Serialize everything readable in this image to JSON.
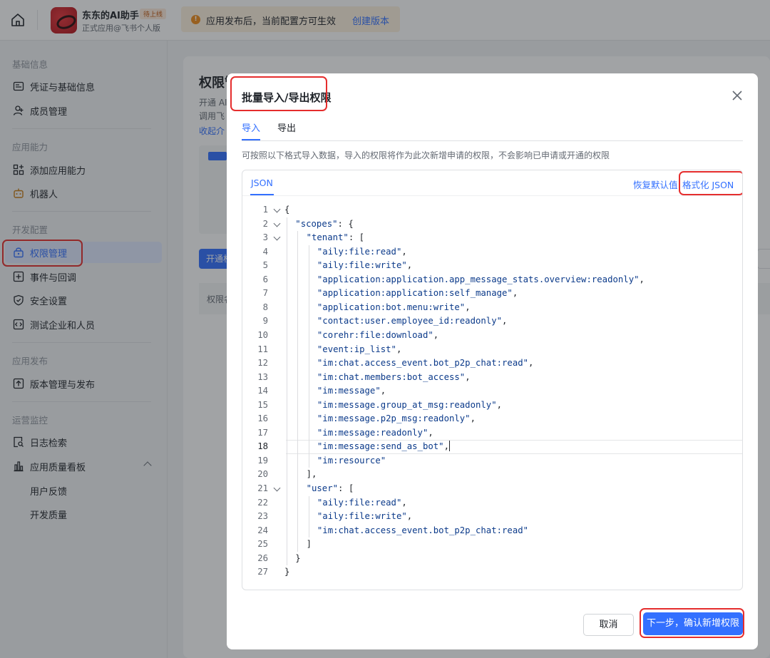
{
  "topbar": {
    "app_name": "东东的AI助手",
    "app_badge": "待上线",
    "app_sub": "正式应用@飞书个人版",
    "notice_text": "应用发布后，当前配置方可生效",
    "notice_link": "创建版本"
  },
  "sidebar": {
    "sections": [
      {
        "title": "基础信息",
        "items": [
          {
            "label": "凭证与基础信息",
            "icon": "credential-icon"
          },
          {
            "label": "成员管理",
            "icon": "member-icon"
          }
        ]
      },
      {
        "title": "应用能力",
        "items": [
          {
            "label": "添加应用能力",
            "icon": "grid-add-icon"
          },
          {
            "label": "机器人",
            "icon": "robot-icon"
          }
        ]
      },
      {
        "title": "开发配置",
        "items": [
          {
            "label": "权限管理",
            "icon": "lock-icon"
          },
          {
            "label": "事件与回调",
            "icon": "event-icon"
          },
          {
            "label": "安全设置",
            "icon": "shield-icon"
          },
          {
            "label": "测试企业和人员",
            "icon": "code-icon"
          }
        ]
      },
      {
        "title": "应用发布",
        "items": [
          {
            "label": "版本管理与发布",
            "icon": "upload-icon"
          }
        ]
      },
      {
        "title": "运营监控",
        "items": [
          {
            "label": "日志检索",
            "icon": "log-search-icon"
          },
          {
            "label": "应用质量看板",
            "icon": "bar-chart-icon"
          },
          {
            "label": "用户反馈"
          },
          {
            "label": "开发质量"
          }
        ]
      }
    ]
  },
  "background": {
    "title": "权限管",
    "line1": "开通 AI",
    "line2": "调用飞",
    "link": "收起介",
    "button": "开通权",
    "table_head": "权限名"
  },
  "modal": {
    "title": "批量导入/导出权限",
    "tabs": [
      "导入",
      "导出"
    ],
    "description": "可按照以下格式导入数据，导入的权限将作为此次新增申请的权限，不会影响已申请或开通的权限",
    "editor": {
      "tab": "JSON",
      "restore": "恢复默认值",
      "format": "格式化 JSON",
      "lines": [
        {
          "n": "1",
          "text": "{"
        },
        {
          "n": "2",
          "key": "\"scopes\"",
          "rest": ": {"
        },
        {
          "n": "3",
          "key": "\"tenant\"",
          "rest": ": ["
        },
        {
          "n": "4",
          "str": "\"aily:file:read\"",
          "rest": ","
        },
        {
          "n": "5",
          "str": "\"aily:file:write\"",
          "rest": ","
        },
        {
          "n": "6",
          "str": "\"application:application.app_message_stats.overview:readonly\"",
          "rest": ","
        },
        {
          "n": "7",
          "str": "\"application:application:self_manage\"",
          "rest": ","
        },
        {
          "n": "8",
          "str": "\"application:bot.menu:write\"",
          "rest": ","
        },
        {
          "n": "9",
          "str": "\"contact:user.employee_id:readonly\"",
          "rest": ","
        },
        {
          "n": "10",
          "str": "\"corehr:file:download\"",
          "rest": ","
        },
        {
          "n": "11",
          "str": "\"event:ip_list\"",
          "rest": ","
        },
        {
          "n": "12",
          "str": "\"im:chat.access_event.bot_p2p_chat:read\"",
          "rest": ","
        },
        {
          "n": "13",
          "str": "\"im:chat.members:bot_access\"",
          "rest": ","
        },
        {
          "n": "14",
          "str": "\"im:message\"",
          "rest": ","
        },
        {
          "n": "15",
          "str": "\"im:message.group_at_msg:readonly\"",
          "rest": ","
        },
        {
          "n": "16",
          "str": "\"im:message.p2p_msg:readonly\"",
          "rest": ","
        },
        {
          "n": "17",
          "str": "\"im:message:readonly\"",
          "rest": ","
        },
        {
          "n": "18",
          "str": "\"im:message:send_as_bot\"",
          "rest": ","
        },
        {
          "n": "19",
          "str": "\"im:resource\"",
          "rest": ""
        },
        {
          "n": "20",
          "text": "],"
        },
        {
          "n": "21",
          "key": "\"user\"",
          "rest": ": ["
        },
        {
          "n": "22",
          "str": "\"aily:file:read\"",
          "rest": ","
        },
        {
          "n": "23",
          "str": "\"aily:file:write\"",
          "rest": ","
        },
        {
          "n": "24",
          "str": "\"im:chat.access_event.bot_p2p_chat:read\"",
          "rest": ""
        },
        {
          "n": "25",
          "text": "]"
        },
        {
          "n": "26",
          "text": "}"
        },
        {
          "n": "27",
          "text": "}"
        }
      ]
    },
    "cancel": "取消",
    "confirm": "下一步，确认新增权限"
  },
  "colors": {
    "accent": "#3370ff",
    "highlight_box": "#e52d2d"
  }
}
